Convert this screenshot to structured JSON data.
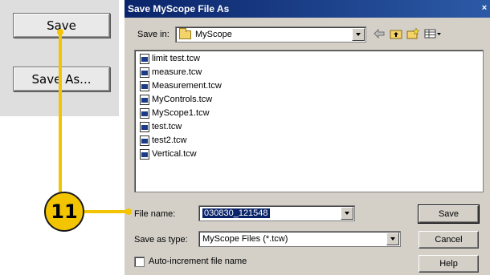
{
  "side_panel": {
    "save_label": "Save",
    "save_as_label": "Save As..."
  },
  "dialog": {
    "title": "Save MyScope File As",
    "close_glyph": "×",
    "save_in_label": "Save in:",
    "save_in_value": "MyScope",
    "files": [
      "limit test.tcw",
      "measure.tcw",
      "Measurement.tcw",
      "MyControls.tcw",
      "MyScope1.tcw",
      "test.tcw",
      "test2.tcw",
      "Vertical.tcw"
    ],
    "file_name_label": "File name:",
    "file_name_value": "030830_121548",
    "save_as_type_label": "Save as type:",
    "save_as_type_value": "MyScope Files (*.tcw)",
    "auto_increment_label": "Auto-increment file name",
    "auto_increment_checked": false,
    "buttons": {
      "save": "Save",
      "cancel": "Cancel",
      "help": "Help"
    },
    "toolbar_icons": [
      "back-icon",
      "up-folder-icon",
      "new-folder-icon",
      "view-menu-icon"
    ]
  },
  "callout": {
    "number": "11",
    "color": "#f2c500"
  }
}
